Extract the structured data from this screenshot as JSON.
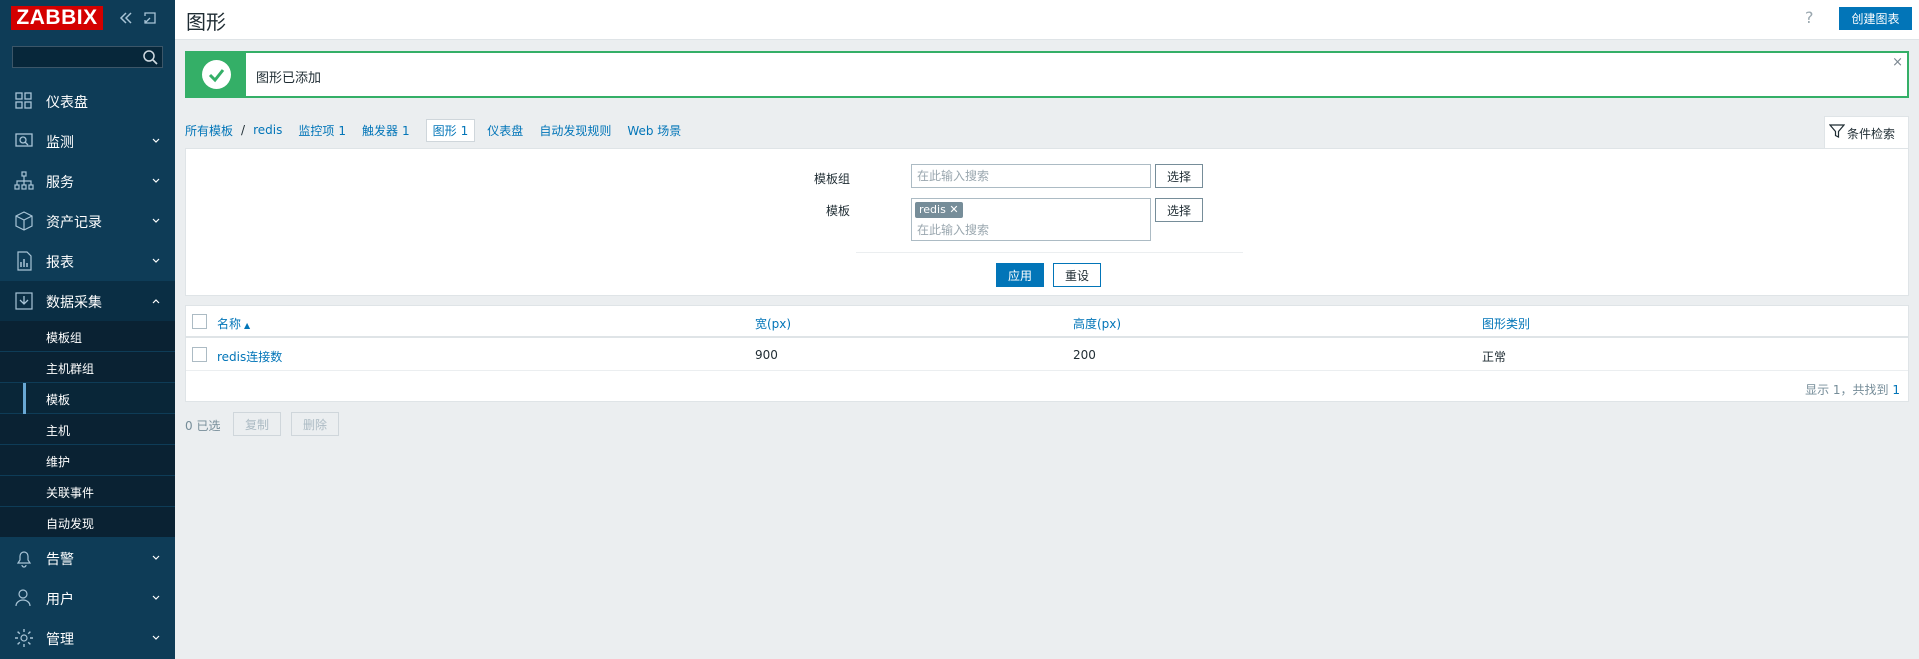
{
  "sidebar": {
    "logo": "ZABBIX",
    "search_placeholder": "",
    "menu": [
      {
        "label": "仪表盘",
        "icon": "dashboard-icon"
      },
      {
        "label": "监测",
        "icon": "monitoring-icon"
      },
      {
        "label": "服务",
        "icon": "services-icon"
      },
      {
        "label": "资产记录",
        "icon": "inventory-icon"
      },
      {
        "label": "报表",
        "icon": "reports-icon"
      },
      {
        "label": "数据采集",
        "icon": "data-collection-icon"
      }
    ],
    "submenu": [
      "模板组",
      "主机群组",
      "模板",
      "主机",
      "维护",
      "关联事件",
      "自动发现"
    ],
    "menu_bottom": [
      {
        "label": "告警",
        "icon": "alerts-icon"
      },
      {
        "label": "用户",
        "icon": "users-icon"
      },
      {
        "label": "管理",
        "icon": "administration-icon"
      }
    ]
  },
  "header": {
    "title": "图形",
    "help": "?",
    "create_button": "创建图表"
  },
  "message": {
    "text": "图形已添加",
    "close": "×"
  },
  "nav": {
    "all_templates": "所有模板",
    "separator": "/",
    "template": "redis",
    "items_label": "监控项",
    "items_count": "1",
    "triggers_label": "触发器",
    "triggers_count": "1",
    "graphs_label": "图形",
    "graphs_count": "1",
    "dashboards_label": "仪表盘",
    "discovery_label": "自动发现规则",
    "web_label": "Web 场景"
  },
  "filter": {
    "tab_label": "条件检索",
    "template_group_label": "模板组",
    "template_group_placeholder": "在此输入搜索",
    "template_label": "模板",
    "template_tag": "redis",
    "template_placeholder": "在此输入搜索",
    "select_label": "选择",
    "apply_label": "应用",
    "reset_label": "重设"
  },
  "table": {
    "columns": [
      "名称",
      "宽(px)",
      "高度(px)",
      "图形类别"
    ],
    "sort_indicator": "▲",
    "rows": [
      {
        "name": "redis连接数",
        "width": "900",
        "height": "200",
        "type": "正常"
      }
    ],
    "pager_prefix": "显示 1，共找到 ",
    "pager_total": "1"
  },
  "actions": {
    "selected": "0 已选",
    "copy": "复制",
    "delete": "删除"
  },
  "colors": {
    "sidebar_bg": "#0e3c57",
    "accent": "#0275b8",
    "success": "#34af67",
    "logo_red": "#d40000"
  }
}
